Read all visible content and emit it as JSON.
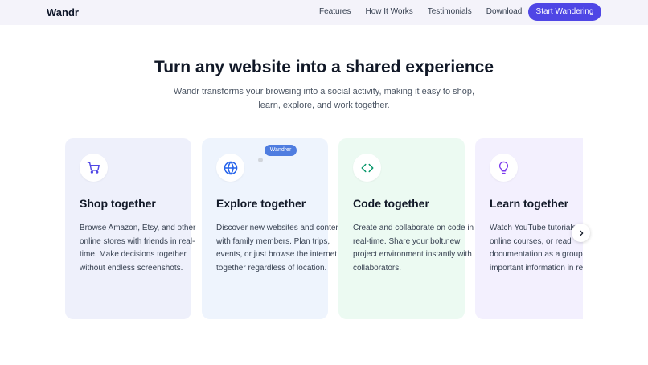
{
  "nav": {
    "brand": "Wandr",
    "links": [
      "Features",
      "How It Works",
      "Testimonials",
      "Download"
    ],
    "cta": "Start Wandering"
  },
  "hero": {
    "title": "Turn any website into a shared experience",
    "subtitle": "Wandr transforms your browsing into a social activity, making it easy to shop, learn, explore, and work together."
  },
  "cards": [
    {
      "icon": "shopping-cart-icon",
      "title": "Shop together",
      "body": "Browse Amazon, Etsy, and other online stores with friends in real-time. Make decisions together without endless screenshots."
    },
    {
      "icon": "globe-icon",
      "title": "Explore together",
      "body": "Discover new websites and content with family members. Plan trips, events, or just browse the internet together regardless of location."
    },
    {
      "icon": "code-icon",
      "title": "Code together",
      "body": "Create and collaborate on code in real-time. Share your bolt.new project environment instantly with collaborators."
    },
    {
      "icon": "lightbulb-icon",
      "title": "Learn together",
      "body": "Watch YouTube tutorials, take online courses, or read documentation as a group. Point to important information in real-time."
    }
  ],
  "cursor_badge": "Wandrer",
  "colors": {
    "accent": "#4f46e5",
    "shop": "#4f46e5",
    "explore": "#2563eb",
    "code": "#059669",
    "learn": "#7c3aed"
  }
}
